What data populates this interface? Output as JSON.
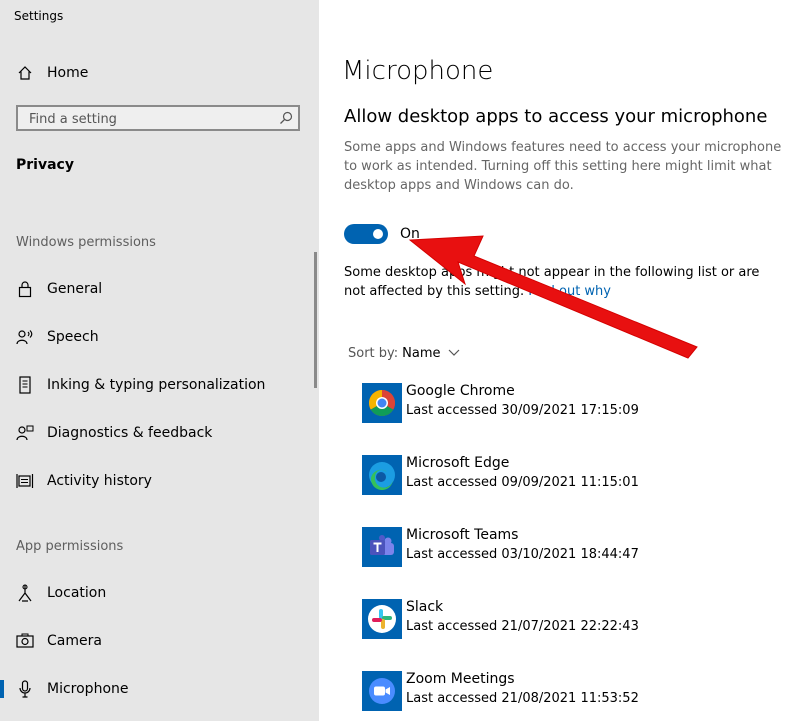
{
  "window": {
    "title": "Settings"
  },
  "sidebar": {
    "home": "Home",
    "search_placeholder": "Find a setting",
    "category": "Privacy",
    "windows_permissions_header": "Windows permissions",
    "windows_permissions": [
      {
        "label": "General",
        "icon": "lock-icon"
      },
      {
        "label": "Speech",
        "icon": "speech-icon"
      },
      {
        "label": "Inking & typing personalization",
        "icon": "inking-icon"
      },
      {
        "label": "Diagnostics & feedback",
        "icon": "diagnostics-icon"
      },
      {
        "label": "Activity history",
        "icon": "activity-history-icon"
      }
    ],
    "app_permissions_header": "App permissions",
    "app_permissions": [
      {
        "label": "Location",
        "icon": "location-icon"
      },
      {
        "label": "Camera",
        "icon": "camera-icon"
      },
      {
        "label": "Microphone",
        "icon": "microphone-icon",
        "selected": true
      }
    ]
  },
  "main": {
    "title": "Microphone",
    "subtitle": "Allow desktop apps to access your microphone",
    "description": "Some apps and Windows features need to access your microphone to work as intended. Turning off this setting here might limit what desktop apps and Windows can do.",
    "toggle": {
      "state": "On",
      "enabled": true
    },
    "note_part1": "Some desktop apps might not appear in the following list or are not affected by this setting. ",
    "note_link": "Find out why",
    "sort_label": "Sort by:",
    "sort_value": "Name",
    "apps": [
      {
        "name": "Google Chrome",
        "last_accessed": "Last accessed 30/09/2021 17:15:09",
        "icon": "chrome-icon"
      },
      {
        "name": "Microsoft Edge",
        "last_accessed": "Last accessed 09/09/2021 11:15:01",
        "icon": "edge-icon"
      },
      {
        "name": "Microsoft Teams",
        "last_accessed": "Last accessed 03/10/2021 18:44:47",
        "icon": "teams-icon"
      },
      {
        "name": "Slack",
        "last_accessed": "Last accessed 21/07/2021 22:22:43",
        "icon": "slack-icon"
      },
      {
        "name": "Zoom Meetings",
        "last_accessed": "Last accessed 21/08/2021 11:53:52",
        "icon": "zoom-icon"
      }
    ]
  },
  "colors": {
    "accent": "#0063b1",
    "annotation_arrow": "#e81010",
    "sidebar_bg": "#e6e6e6"
  }
}
